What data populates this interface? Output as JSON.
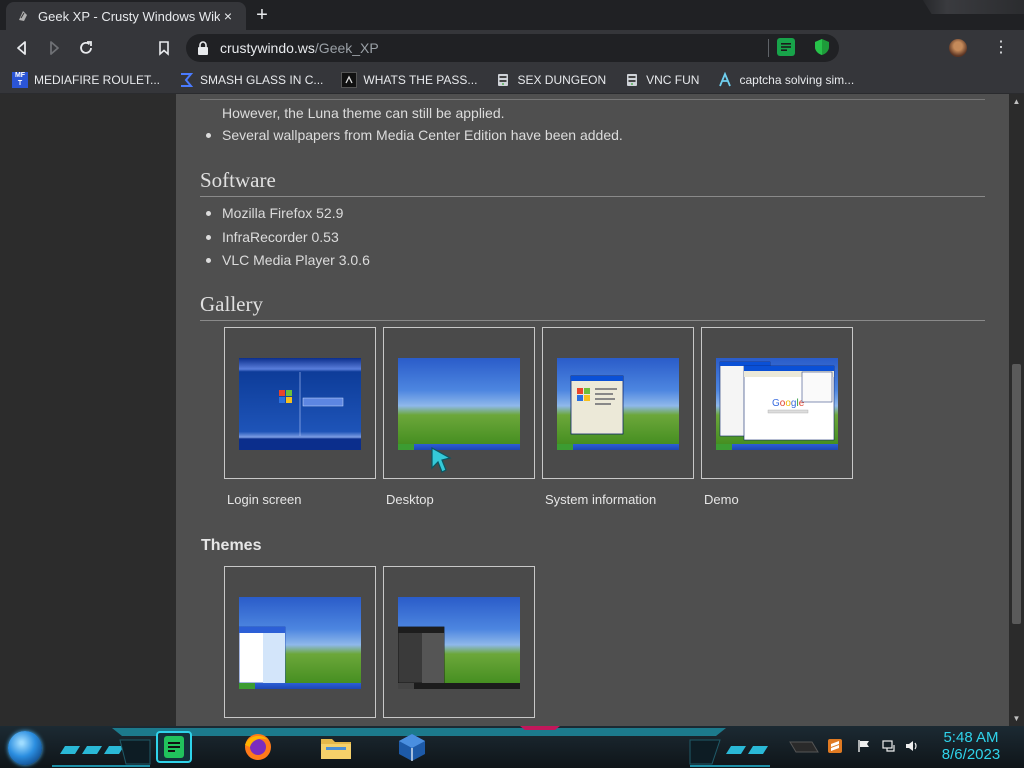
{
  "tab": {
    "title": "Geek XP - Crusty Windows Wiki",
    "close_icon": "×",
    "favicon": "crusty-favicon"
  },
  "newtab_icon": "+",
  "toolbar": {
    "back": "◁",
    "forward": "▷",
    "reload": "↻",
    "bookmark": "bookmark-icon",
    "menu": "⋮"
  },
  "omnibox": {
    "host": "crustywindo.ws",
    "path": "/Geek_XP"
  },
  "bookmarks": [
    {
      "label": "MEDIAFIRE ROULET...",
      "icon": "mediafire-icon"
    },
    {
      "label": "SMASH GLASS IN C...",
      "icon": "sigma-icon"
    },
    {
      "label": "WHATS THE PASS...",
      "icon": "dark-square-icon"
    },
    {
      "label": "SEX DUNGEON",
      "icon": "server-icon"
    },
    {
      "label": "VNC FUN",
      "icon": "server-icon"
    },
    {
      "label": "captcha solving sim...",
      "icon": "lambda-icon"
    }
  ],
  "page": {
    "top_bullets": [
      "However, the Luna theme can still be applied.",
      "Several wallpapers from Media Center Edition have been added."
    ],
    "software_heading": "Software",
    "software": [
      "Mozilla Firefox 52.9",
      "InfraRecorder 0.53",
      "VLC Media Player 3.0.6"
    ],
    "gallery_heading": "Gallery",
    "gallery": [
      {
        "caption": "Login screen",
        "kind": "login"
      },
      {
        "caption": "Desktop",
        "kind": "desktop"
      },
      {
        "caption": "System information",
        "kind": "sysinfo"
      },
      {
        "caption": "Demo",
        "kind": "demo"
      }
    ],
    "themes_heading": "Themes",
    "themes": [
      {
        "kind": "luna-blue"
      },
      {
        "kind": "dark"
      }
    ]
  },
  "taskbar": {
    "pinned": [
      "notes-app-icon",
      "firefox-icon",
      "file-explorer-icon",
      "virtualbox-icon"
    ],
    "tray": [
      "sublime-icon",
      "flag-icon",
      "network-icon",
      "volume-icon"
    ],
    "time": "5:48 AM",
    "date": "8/6/2023"
  },
  "colors": {
    "accent": "#2fd3ea",
    "page_bg": "#4f4f4f",
    "browser_chrome": "#35363a"
  }
}
